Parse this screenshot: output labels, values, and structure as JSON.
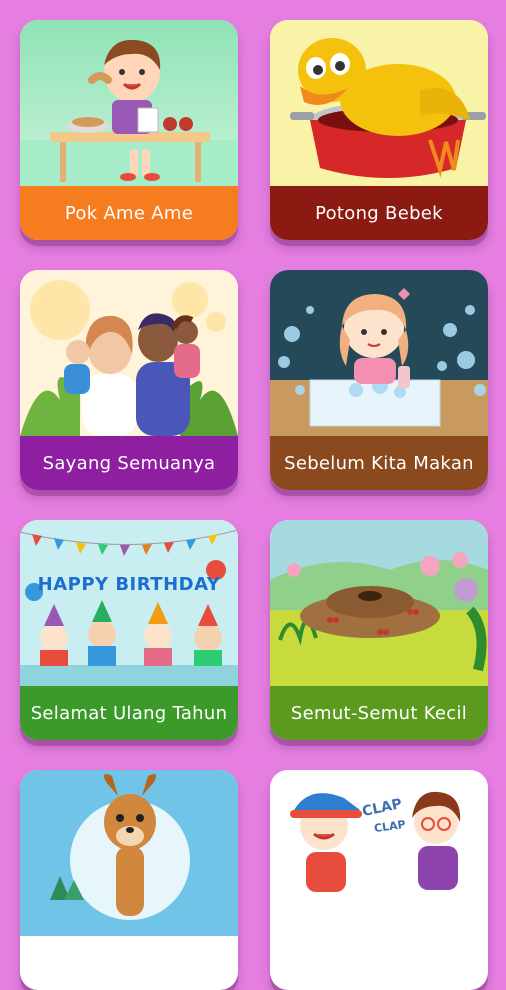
{
  "songs": [
    {
      "title": "Pok Ame Ame",
      "color": "#f57c1f"
    },
    {
      "title": "Potong Bebek",
      "color": "#8a1a12"
    },
    {
      "title": "Sayang Semuanya",
      "color": "#8e1fa0"
    },
    {
      "title": "Sebelum Kita Makan",
      "color": "#8a4a1e"
    },
    {
      "title": "Selamat Ulang Tahun",
      "color": "#3b9a2a"
    },
    {
      "title": "Semut-Semut Kecil",
      "color": "#5b9a1f"
    },
    {
      "title": "",
      "color": "#2f8fd0"
    },
    {
      "title": "",
      "color": "#d03a3a"
    }
  ],
  "cards": {
    "birthday_banner": "HAPPY BIRTHDAY",
    "clap_text_1": "CLAP",
    "clap_text_2": "CLAP"
  },
  "icons": [
    "girl-eating-illustration",
    "duck-in-pot-illustration",
    "family-illustration",
    "girl-washing-hands-illustration",
    "birthday-kids-illustration",
    "ant-hill-illustration",
    "deer-illustration",
    "kids-clapping-illustration"
  ]
}
